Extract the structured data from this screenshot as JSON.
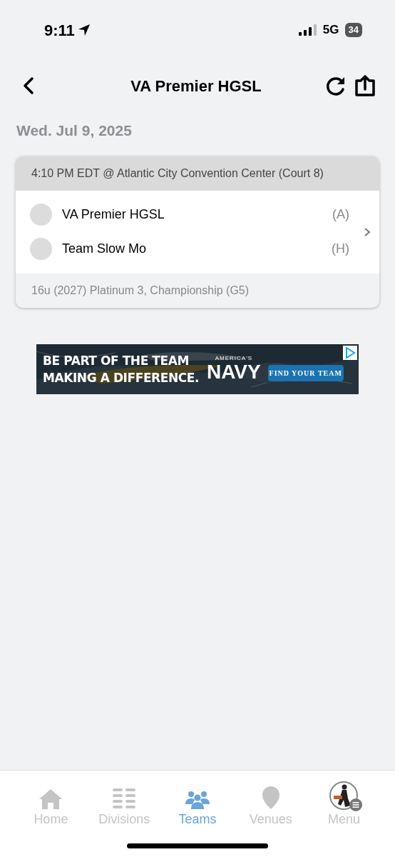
{
  "status_bar": {
    "time": "9:11",
    "network": "5G",
    "battery": "34"
  },
  "header": {
    "title": "VA Premier HGSL"
  },
  "date": "Wed. Jul 9, 2025",
  "game": {
    "time_venue": "4:10 PM EDT @ Atlantic City Convention Center (Court 8)",
    "teams": [
      {
        "name": "VA Premier HGSL",
        "side": "(A)"
      },
      {
        "name": "Team Slow Mo",
        "side": "(H)"
      }
    ],
    "division": "16u (2027) Platinum 3, Championship (G5)"
  },
  "ad": {
    "headline": "BE PART OF THE TEAM MAKING A DIFFERENCE.",
    "brand_small": "AMERICA'S",
    "brand": "NAVY",
    "cta": "FIND YOUR TEAM"
  },
  "tabs": [
    {
      "label": "Home",
      "kind": "home",
      "selected": false
    },
    {
      "label": "Divisions",
      "kind": "divisions",
      "selected": false
    },
    {
      "label": "Teams",
      "kind": "teams",
      "selected": true
    },
    {
      "label": "Venues",
      "kind": "venues",
      "selected": false
    },
    {
      "label": "Menu",
      "kind": "menu",
      "selected": false
    }
  ]
}
